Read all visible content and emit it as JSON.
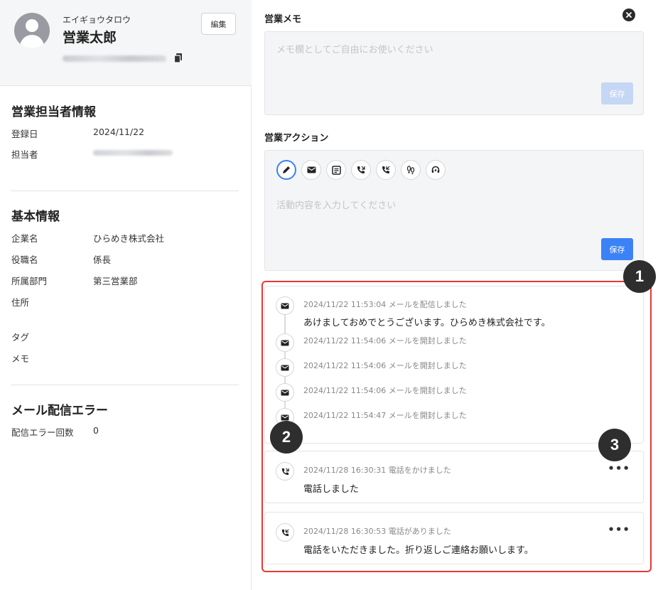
{
  "profile": {
    "kana": "エイギョウタロウ",
    "name": "営業太郎",
    "edit_label": "編集"
  },
  "sales_rep": {
    "title": "営業担当者情報",
    "registered_label": "登録日",
    "registered_value": "2024/11/22",
    "owner_label": "担当者"
  },
  "basic": {
    "title": "基本情報",
    "rows": [
      {
        "label": "企業名",
        "value": "ひらめき株式会社"
      },
      {
        "label": "役職名",
        "value": "係長"
      },
      {
        "label": "所属部門",
        "value": "第三営業部"
      },
      {
        "label": "住所",
        "value": ""
      },
      {
        "label": "タグ",
        "value": ""
      },
      {
        "label": "メモ",
        "value": ""
      }
    ]
  },
  "mail_error": {
    "title": "メール配信エラー",
    "count_label": "配信エラー回数",
    "count_value": "0"
  },
  "memo": {
    "label": "営業メモ",
    "placeholder": "メモ欄としてご自由にお使いください",
    "save_label": "保存"
  },
  "action": {
    "label": "営業アクション",
    "placeholder": "活動内容を入力してください",
    "save_label": "保存",
    "icons": [
      "pencil-icon",
      "mail-icon",
      "form-icon",
      "phone-outgoing-icon",
      "phone-incoming-icon",
      "footprints-icon",
      "headset-icon"
    ]
  },
  "timeline": {
    "mail_card": {
      "events": [
        {
          "meta": "2024/11/22 11:53:04  メールを配信しました",
          "body": "あけましておめでとうございます。ひらめき株式会社です。"
        },
        {
          "meta": "2024/11/22 11:54:06  メールを開封しました",
          "body": ""
        },
        {
          "meta": "2024/11/22 11:54:06  メールを開封しました",
          "body": ""
        },
        {
          "meta": "2024/11/22 11:54:06  メールを開封しました",
          "body": ""
        },
        {
          "meta": "2024/11/22 11:54:47  メールを開封しました",
          "body": ""
        }
      ]
    },
    "call_cards": [
      {
        "meta": "2024/11/28 16:30:31  電話をかけました",
        "body": "電話しました",
        "more": "•••"
      },
      {
        "meta": "2024/11/28 16:30:53  電話がありました",
        "body": "電話をいただきました。折り返しご連絡お願いします。",
        "more": "•••"
      }
    ]
  },
  "badges": [
    "1",
    "2",
    "3"
  ],
  "colors": {
    "accent": "#3b82f6",
    "highlight_frame": "#e53935",
    "badge": "#2e2e2e"
  }
}
